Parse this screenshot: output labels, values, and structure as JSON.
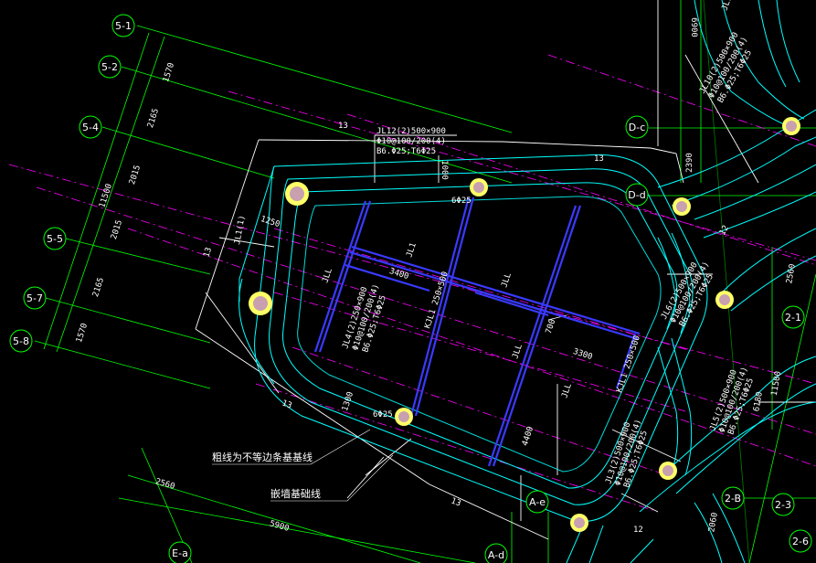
{
  "axes": {
    "left": [
      "5-1",
      "5-2",
      "5-4",
      "5-5",
      "5-7",
      "5-8"
    ],
    "top_right": [
      "D-c",
      "D-d"
    ],
    "right": [
      "2-1",
      "2-B",
      "2-3",
      "2-6"
    ],
    "bottom": [
      "E-a",
      "A-d",
      "A-e"
    ]
  },
  "dimensions": {
    "left_chain": [
      "1570",
      "2165",
      "2015",
      "2015",
      "2165",
      "1570"
    ],
    "left_total": "11500",
    "bottom_1": "2560",
    "bottom_2": "5900",
    "top_right_1": "6900",
    "top_right_2": "2390",
    "right_1": "2560",
    "right_2": "6180",
    "right_3": "11500",
    "right_4": "2060",
    "inner": [
      "1250",
      "3400",
      "1300",
      "3300",
      "4400",
      "1000",
      "700"
    ]
  },
  "labels": {
    "num_13": "13",
    "num_12": "12",
    "jl1": "JL1",
    "jll": "JLL"
  },
  "notes": {
    "jl12_title": "JL12(2)500×900",
    "jl12_bar1": "Φ10@100/200(4)",
    "jl12_bar2": "B6.Φ25;T6Φ25",
    "jl1_vertical": "JL1(1)",
    "jl1_dim": "1000",
    "jl4_title": "JL4(2)250×900",
    "jl4_bar1": "Φ10@100/200(4)",
    "jl4_bar2": "B6.Φ25;T6Φ25",
    "kjl1": "KJL1 250×500",
    "kjl2": "KJL1 250×500",
    "phi_a": "6Φ25",
    "phi_b": "6Φ25",
    "tr_title": "JL10(2)500×900",
    "tr_bar1": "Φ10@100/200(4)",
    "tr_bar2": "B6.Φ25;T6Φ25",
    "mid_title": "JL6(2)500×900",
    "mid_bar1": "Φ10@100/200(4)",
    "mid_bar2": "B6.Φ25;T6Φ25",
    "r_title": "JL5(2)500×900",
    "r_bar1": "Φ10@100/200(4)",
    "r_bar2": "B6.Φ25;T6Φ25",
    "b_title": "JL3(2)500×900",
    "b_bar1": "Φ10@100/200(4)",
    "b_bar2": "B6.Φ25;T6Φ25",
    "top_right_text": "JL10(2)500"
  },
  "callouts": {
    "line1": "粗线为不等边条基基线",
    "line2": "嵌墙基础线"
  },
  "colors": {
    "axis": "#00ff00",
    "grid": "#00ff00",
    "centerline": "#ff00ff",
    "beam_outline": "#00ffff",
    "foundation": "#ffffff",
    "inner_beam": "#3a3aff",
    "column": "#ffff66"
  }
}
